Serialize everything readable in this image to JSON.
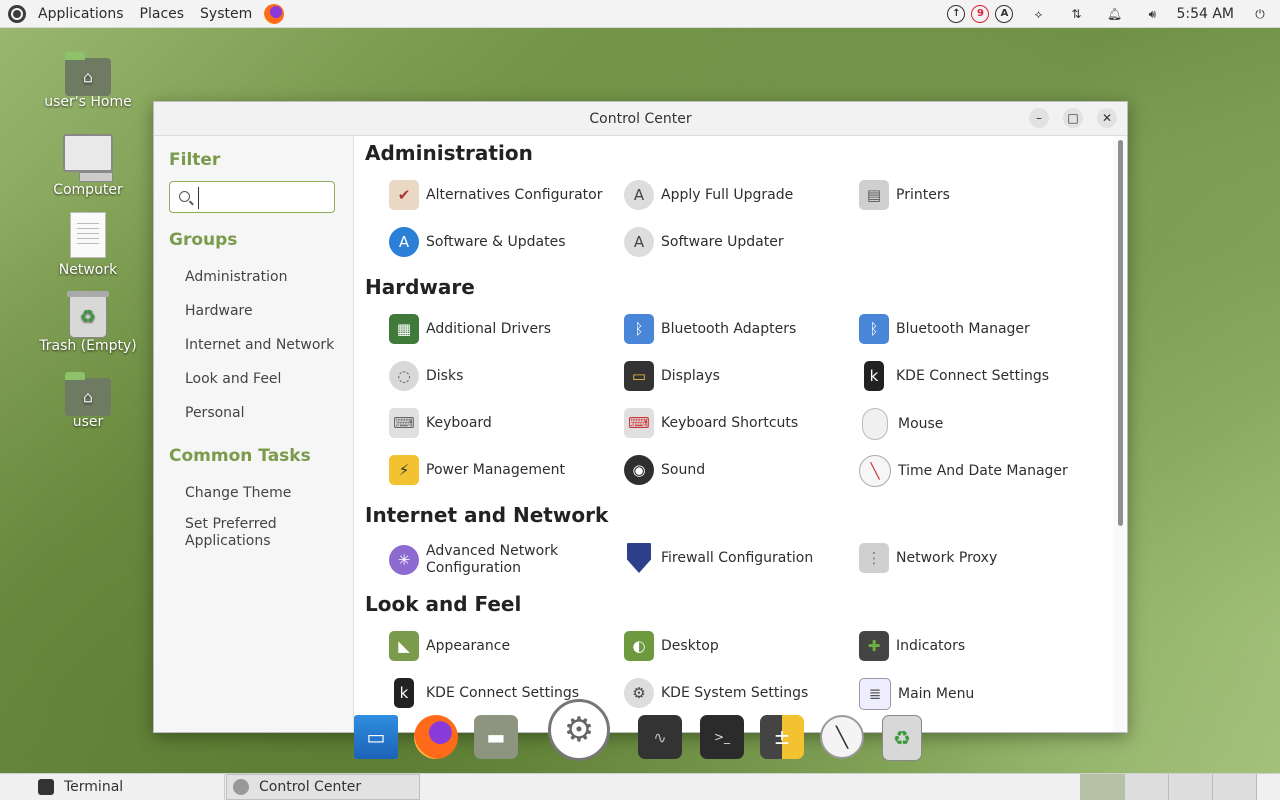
{
  "top_panel": {
    "menus": [
      "Applications",
      "Places",
      "System"
    ],
    "tray": {
      "updates_badge": "9",
      "clock": "5:54 AM"
    }
  },
  "desktop": {
    "icons": [
      {
        "label": "user's Home"
      },
      {
        "label": "Computer"
      },
      {
        "label": "Network"
      },
      {
        "label": "Trash (Empty)"
      },
      {
        "label": "user"
      }
    ]
  },
  "window": {
    "title": "Control Center",
    "sidebar": {
      "filter_heading": "Filter",
      "filter_value": "",
      "groups_heading": "Groups",
      "groups": [
        "Administration",
        "Hardware",
        "Internet and Network",
        "Look and Feel",
        "Personal"
      ],
      "tasks_heading": "Common Tasks",
      "tasks": [
        "Change Theme",
        "Set Preferred Applications"
      ]
    },
    "sections": [
      {
        "title": "Administration",
        "items": [
          "Alternatives Configurator",
          "Apply Full Upgrade",
          "Printers",
          "Software & Updates",
          "Software Updater"
        ]
      },
      {
        "title": "Hardware",
        "items": [
          "Additional Drivers",
          "Bluetooth Adapters",
          "Bluetooth Manager",
          "Disks",
          "Displays",
          "KDE Connect Settings",
          "Keyboard",
          "Keyboard Shortcuts",
          "Mouse",
          "Power Management",
          "Sound",
          "Time And Date Manager"
        ]
      },
      {
        "title": "Internet and Network",
        "items": [
          "Advanced Network Configuration",
          "Firewall Configuration",
          "Network Proxy"
        ]
      },
      {
        "title": "Look and Feel",
        "items": [
          "Appearance",
          "Desktop",
          "Indicators",
          "KDE Connect Settings",
          "KDE System Settings",
          "Main Menu"
        ]
      }
    ]
  },
  "taskbar": {
    "tasks": [
      "Terminal",
      "Control Center"
    ]
  },
  "colors": {
    "accent": "#7a9a4c",
    "panel": "#f3f3f3"
  }
}
